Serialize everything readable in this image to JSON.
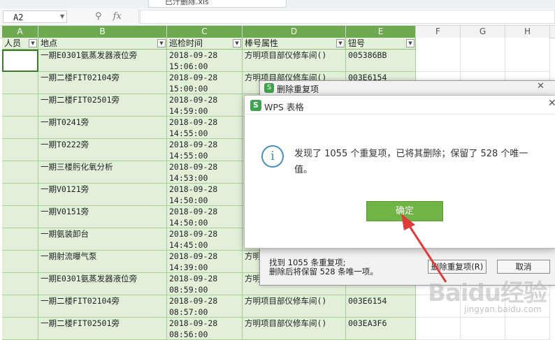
{
  "window": {
    "tab_title": "已汁删除.xls"
  },
  "formula_bar": {
    "cell_ref": "A2",
    "fx_label": "fx",
    "zoom_icon": "magnifier-icon"
  },
  "columns": [
    "A",
    "B",
    "C",
    "D",
    "E",
    "F",
    "G",
    "H"
  ],
  "table": {
    "headers": [
      "人员",
      "地点",
      "巡检时间",
      "棒号属性",
      "钮号"
    ],
    "rows": [
      {
        "person": "",
        "location": "一期E0301氨蒸发器液位旁",
        "time1": "2018-09-28",
        "time2": "15:06:00",
        "attr": "方明项目部仪修车间()",
        "code": "005386BB"
      },
      {
        "person": "",
        "location": "一期二楼FIT02104旁",
        "time1": "2018-09-28",
        "time2": "15:00:00",
        "attr": "方明项目部仪修车间()",
        "code": "003E6154"
      },
      {
        "person": "",
        "location": "一期二楼FIT02501旁",
        "time1": "2018-09-28",
        "time2": "14:59:00",
        "attr": "",
        "code": ""
      },
      {
        "person": "",
        "location": "一期T0241旁",
        "time1": "2018-09-28",
        "time2": "14:55:00",
        "attr": "",
        "code": ""
      },
      {
        "person": "",
        "location": "一期T0222旁",
        "time1": "2018-09-28",
        "time2": "14:55:00",
        "attr": "",
        "code": ""
      },
      {
        "person": "",
        "location": "一期三楼肟化氧分析",
        "time1": "2018-09-28",
        "time2": "14:53:00",
        "attr": "",
        "code": ""
      },
      {
        "person": "",
        "location": "一期V0121旁",
        "time1": "2018-09-28",
        "time2": "14:50:00",
        "attr": "",
        "code": ""
      },
      {
        "person": "",
        "location": "一期V0151旁",
        "time1": "2018-09-28",
        "time2": "14:50:00",
        "attr": "",
        "code": ""
      },
      {
        "person": "",
        "location": "一期氨装卸台",
        "time1": "2018-09-28",
        "time2": "14:45:00",
        "attr": "",
        "code": ""
      },
      {
        "person": "",
        "location": "一期射流曝气泵",
        "time1": "2018-09-28",
        "time2": "14:39:00",
        "attr": "方明",
        "code": ""
      },
      {
        "person": "",
        "location": "一期E0301氨蒸发器液位旁",
        "time1": "2018-09-28",
        "time2": "08:59:00",
        "attr": "方明",
        "code": ""
      },
      {
        "person": "",
        "location": "一期二楼FIT02104旁",
        "time1": "2018-09-28",
        "time2": "08:57:00",
        "attr": "方明项目部仪修车间()",
        "code": "003E6154"
      },
      {
        "person": "",
        "location": "一期二楼FIT02501旁",
        "time1": "2018-09-28",
        "time2": "08:56:00",
        "attr": "方明项目部仪修车间()",
        "code": "003EA3F6"
      }
    ]
  },
  "dialog_back": {
    "title": "删除重复项",
    "found_text": "找到 1055 条重复项;",
    "kept_text": "删除后将保留 528 条唯一项。",
    "delete_button": "删除重复项(R)",
    "cancel_button": "取消"
  },
  "dialog_front": {
    "title": "WPS 表格",
    "logo": "S",
    "message_line1": "发现了 1055 个重复项，已将其删除；保留了 528 个唯一",
    "message_line2": "值。",
    "ok_button": "确定",
    "icon": "info-icon"
  },
  "watermark": {
    "brand": "Baidu经验",
    "url": "jingyan.baidu.com"
  },
  "accent_colors": {
    "green": "#6fb444",
    "cell_fill": "#e2f0d9",
    "arrow_red": "#e03a3a"
  }
}
